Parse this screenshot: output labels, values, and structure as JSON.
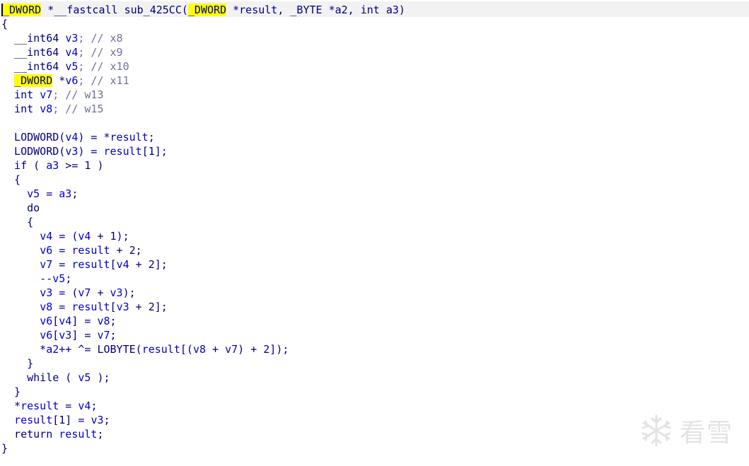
{
  "editor": {
    "lines": [
      [
        {
          "t": "_DWORD",
          "c": "hl",
          "cursor": true
        },
        {
          "t": " *__fastcall sub_425CC(",
          "c": "plain"
        },
        {
          "t": "_DWORD",
          "c": "hl"
        },
        {
          "t": " *result, _BYTE *a2, int a3)",
          "c": "plain"
        }
      ],
      [
        {
          "t": "{",
          "c": "punct"
        }
      ],
      [
        {
          "t": "  __int64 ",
          "c": "type"
        },
        {
          "t": "v3",
          "c": "var"
        },
        {
          "t": "; // x8",
          "c": "cmt"
        }
      ],
      [
        {
          "t": "  __int64 ",
          "c": "type"
        },
        {
          "t": "v4",
          "c": "var"
        },
        {
          "t": "; // x9",
          "c": "cmt"
        }
      ],
      [
        {
          "t": "  __int64 ",
          "c": "type"
        },
        {
          "t": "v5",
          "c": "var"
        },
        {
          "t": "; // x10",
          "c": "cmt"
        }
      ],
      [
        {
          "t": "  ",
          "c": "plain"
        },
        {
          "t": "_DWORD",
          "c": "hl"
        },
        {
          "t": " *",
          "c": "plain"
        },
        {
          "t": "v6",
          "c": "var"
        },
        {
          "t": "; // x11",
          "c": "cmt"
        }
      ],
      [
        {
          "t": "  int ",
          "c": "type"
        },
        {
          "t": "v7",
          "c": "var"
        },
        {
          "t": "; // w13",
          "c": "cmt"
        }
      ],
      [
        {
          "t": "  int ",
          "c": "type"
        },
        {
          "t": "v8",
          "c": "var"
        },
        {
          "t": "; // w15",
          "c": "cmt"
        }
      ],
      [
        {
          "t": "",
          "c": "plain"
        }
      ],
      [
        {
          "t": "  LODWORD(",
          "c": "fn"
        },
        {
          "t": "v4",
          "c": "var"
        },
        {
          "t": ") = *",
          "c": "punct"
        },
        {
          "t": "result",
          "c": "var"
        },
        {
          "t": ";",
          "c": "punct"
        }
      ],
      [
        {
          "t": "  LODWORD(",
          "c": "fn"
        },
        {
          "t": "v3",
          "c": "var"
        },
        {
          "t": ") = ",
          "c": "punct"
        },
        {
          "t": "result",
          "c": "var"
        },
        {
          "t": "[1];",
          "c": "punct"
        }
      ],
      [
        {
          "t": "  if ( ",
          "c": "kw"
        },
        {
          "t": "a3",
          "c": "var"
        },
        {
          "t": " >= 1 )",
          "c": "punct"
        }
      ],
      [
        {
          "t": "  {",
          "c": "punct"
        }
      ],
      [
        {
          "t": "    ",
          "c": "plain"
        },
        {
          "t": "v5",
          "c": "var"
        },
        {
          "t": " = ",
          "c": "punct"
        },
        {
          "t": "a3",
          "c": "var"
        },
        {
          "t": ";",
          "c": "punct"
        }
      ],
      [
        {
          "t": "    do",
          "c": "kw"
        }
      ],
      [
        {
          "t": "    {",
          "c": "punct"
        }
      ],
      [
        {
          "t": "      ",
          "c": "plain"
        },
        {
          "t": "v4",
          "c": "var"
        },
        {
          "t": " = (",
          "c": "punct"
        },
        {
          "t": "v4",
          "c": "var"
        },
        {
          "t": " + 1);",
          "c": "punct"
        }
      ],
      [
        {
          "t": "      ",
          "c": "plain"
        },
        {
          "t": "v6",
          "c": "var"
        },
        {
          "t": " = ",
          "c": "punct"
        },
        {
          "t": "result",
          "c": "var"
        },
        {
          "t": " + 2;",
          "c": "punct"
        }
      ],
      [
        {
          "t": "      ",
          "c": "plain"
        },
        {
          "t": "v7",
          "c": "var"
        },
        {
          "t": " = ",
          "c": "punct"
        },
        {
          "t": "result",
          "c": "var"
        },
        {
          "t": "[",
          "c": "punct"
        },
        {
          "t": "v4",
          "c": "var"
        },
        {
          "t": " + 2];",
          "c": "punct"
        }
      ],
      [
        {
          "t": "      --",
          "c": "punct"
        },
        {
          "t": "v5",
          "c": "var"
        },
        {
          "t": ";",
          "c": "punct"
        }
      ],
      [
        {
          "t": "      ",
          "c": "plain"
        },
        {
          "t": "v3",
          "c": "var"
        },
        {
          "t": " = (",
          "c": "punct"
        },
        {
          "t": "v7",
          "c": "var"
        },
        {
          "t": " + ",
          "c": "punct"
        },
        {
          "t": "v3",
          "c": "var"
        },
        {
          "t": ");",
          "c": "punct"
        }
      ],
      [
        {
          "t": "      ",
          "c": "plain"
        },
        {
          "t": "v8",
          "c": "var"
        },
        {
          "t": " = ",
          "c": "punct"
        },
        {
          "t": "result",
          "c": "var"
        },
        {
          "t": "[",
          "c": "punct"
        },
        {
          "t": "v3",
          "c": "var"
        },
        {
          "t": " + 2];",
          "c": "punct"
        }
      ],
      [
        {
          "t": "      ",
          "c": "plain"
        },
        {
          "t": "v6",
          "c": "var"
        },
        {
          "t": "[",
          "c": "punct"
        },
        {
          "t": "v4",
          "c": "var"
        },
        {
          "t": "] = ",
          "c": "punct"
        },
        {
          "t": "v8",
          "c": "var"
        },
        {
          "t": ";",
          "c": "punct"
        }
      ],
      [
        {
          "t": "      ",
          "c": "plain"
        },
        {
          "t": "v6",
          "c": "var"
        },
        {
          "t": "[",
          "c": "punct"
        },
        {
          "t": "v3",
          "c": "var"
        },
        {
          "t": "] = ",
          "c": "punct"
        },
        {
          "t": "v7",
          "c": "var"
        },
        {
          "t": ";",
          "c": "punct"
        }
      ],
      [
        {
          "t": "      *",
          "c": "punct"
        },
        {
          "t": "a2",
          "c": "var"
        },
        {
          "t": "++ ^= LOBYTE(",
          "c": "fn"
        },
        {
          "t": "result",
          "c": "var"
        },
        {
          "t": "[(",
          "c": "punct"
        },
        {
          "t": "v8",
          "c": "var"
        },
        {
          "t": " + ",
          "c": "punct"
        },
        {
          "t": "v7",
          "c": "var"
        },
        {
          "t": ") + 2]);",
          "c": "punct"
        }
      ],
      [
        {
          "t": "    }",
          "c": "punct"
        }
      ],
      [
        {
          "t": "    while ( ",
          "c": "kw"
        },
        {
          "t": "v5",
          "c": "var"
        },
        {
          "t": " );",
          "c": "punct"
        }
      ],
      [
        {
          "t": "  }",
          "c": "punct"
        }
      ],
      [
        {
          "t": "  *",
          "c": "punct"
        },
        {
          "t": "result",
          "c": "var"
        },
        {
          "t": " = ",
          "c": "punct"
        },
        {
          "t": "v4",
          "c": "var"
        },
        {
          "t": ";",
          "c": "punct"
        }
      ],
      [
        {
          "t": "  ",
          "c": "plain"
        },
        {
          "t": "result",
          "c": "var"
        },
        {
          "t": "[1] = ",
          "c": "punct"
        },
        {
          "t": "v3",
          "c": "var"
        },
        {
          "t": ";",
          "c": "punct"
        }
      ],
      [
        {
          "t": "  return ",
          "c": "kw"
        },
        {
          "t": "result",
          "c": "var"
        },
        {
          "t": ";",
          "c": "punct"
        }
      ],
      [
        {
          "t": "}",
          "c": "punct"
        }
      ]
    ]
  },
  "watermark": {
    "text": "看雪",
    "icon": "snowflake-icon"
  },
  "colors": {
    "background": "#ffffff",
    "header_background": "#f2f2f2",
    "code_text": "#000080",
    "variable": "#0000cc",
    "comment": "#7070a0",
    "highlight": "#ffff00",
    "watermark": "#e3e3e3"
  }
}
